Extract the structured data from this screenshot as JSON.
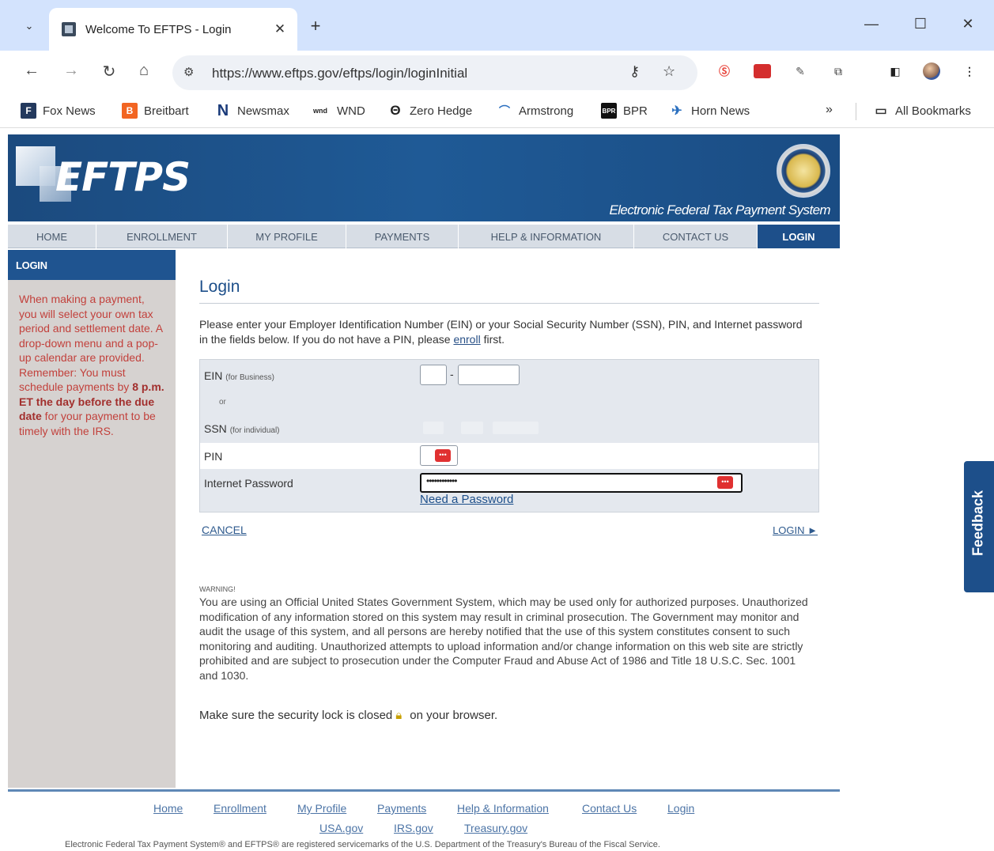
{
  "browser": {
    "tab_title": "Welcome To EFTPS - Login",
    "url": "https://www.eftps.gov/eftps/login/loginInitial",
    "bookmarks": [
      "Fox News",
      "Breitbart",
      "Newsmax",
      "WND",
      "Zero Hedge",
      "Armstrong",
      "BPR",
      "Horn News"
    ],
    "bookmarks_overflow": "»",
    "all_bookmarks": "All Bookmarks"
  },
  "banner": {
    "logo": "EFTPS",
    "tagline": "Electronic Federal Tax Payment System"
  },
  "nav": {
    "items": [
      "HOME",
      "ENROLLMENT",
      "MY PROFILE",
      "PAYMENTS",
      "HELP & INFORMATION",
      "CONTACT US",
      "LOGIN"
    ],
    "active": "LOGIN"
  },
  "sidebar": {
    "heading": "LOGIN",
    "text_pre": "When making a payment, you will select your own tax period and settlement date. A drop-down menu and a pop-up calendar are provided. Remember: You must schedule payments by ",
    "text_bold1": "8 p.m. ET the day before the due date",
    "text_post": " for your payment to be timely with the IRS."
  },
  "login": {
    "title": "Login",
    "intro_pre": "Please enter your Employer Identification Number (EIN) or your Social Security Number (SSN), PIN, and Internet password in the fields below. If you do not have a PIN, please ",
    "intro_link": "enroll",
    "intro_post": " first.",
    "ein_label": "EIN",
    "ein_sub": "(for Business)",
    "or": "or",
    "ssn_label": "SSN",
    "ssn_sub": "(for individual)",
    "pin_label": "PIN",
    "password_label": "Internet Password",
    "password_value": "••••••••••••",
    "need_password": "Need a Password",
    "cancel": "CANCEL",
    "login_button": "LOGIN ►"
  },
  "warning": {
    "heading": "WARNING!",
    "body": "You are using an Official United States Government System, which may be used only for authorized purposes. Unauthorized modification of any information stored on this system may result in criminal prosecution. The Government may monitor and audit the usage of this system, and all persons are hereby notified that the use of this system constitutes consent to such monitoring and auditing. Unauthorized attempts to upload information and/or change information on this web site are strictly prohibited and are subject to prosecution under the Computer Fraud and Abuse Act of 1986 and Title 18 U.S.C. Sec. 1001 and 1030.",
    "lock_pre": "Make sure the security lock is closed",
    "lock_post": "on your browser."
  },
  "footer": {
    "links": [
      "Home",
      "Enrollment",
      "My Profile",
      "Payments",
      "Help & Information",
      "Contact Us",
      "Login"
    ],
    "gov_links": [
      "USA.gov",
      "IRS.gov",
      "Treasury.gov"
    ],
    "note": "Electronic Federal Tax Payment System® and EFTPS® are registered servicemarks of the U.S. Department of the Treasury's Bureau of the Fiscal Service."
  },
  "feedback": "Feedback"
}
